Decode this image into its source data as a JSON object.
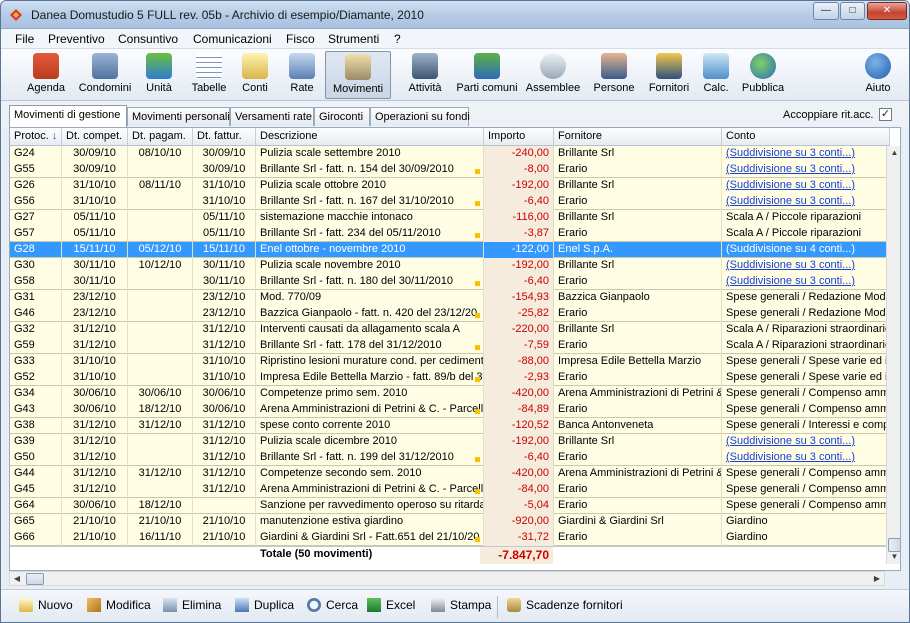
{
  "window": {
    "title": "Danea Domustudio 5 FULL rev. 05b - Archivio di esempio/Diamante, 2010"
  },
  "menu": [
    "File",
    "Preventivo",
    "Consuntivo",
    "Comunicazioni",
    "Fisco",
    "Strumenti",
    "?"
  ],
  "toolbar": [
    "Agenda",
    "Condomini",
    "Unità",
    "Tabelle",
    "Conti",
    "Rate",
    "Movimenti",
    "Attività",
    "Parti comuni",
    "Assemblee",
    "Persone",
    "Fornitori",
    "Calc.",
    "Pubblica",
    "Aiuto"
  ],
  "tabs": [
    "Movimenti di gestione",
    "Movimenti personali",
    "Versamenti rate",
    "Giroconti",
    "Operazioni su fondi"
  ],
  "accoppiare_label": "Accoppiare rit.acc.",
  "columns": [
    "Protoc.",
    "Dt. compet.",
    "Dt. pagam.",
    "Dt. fattur.",
    "Descrizione",
    "Importo",
    "Fornitore",
    "Conto"
  ],
  "rows": [
    [
      "G24",
      "30/09/10",
      "08/10/10",
      "30/09/10",
      "Pulizia scale settembre 2010",
      "-240,00",
      "Brillante Srl",
      "(Suddivisione su 3 conti...)"
    ],
    [
      "G55",
      "30/09/10",
      "",
      "30/09/10",
      "Brillante Srl - fatt. n. 154 del 30/09/2010",
      "-8,00",
      "Erario",
      "(Suddivisione su 3 conti...)"
    ],
    [
      "G26",
      "31/10/10",
      "08/11/10",
      "31/10/10",
      "Pulizia scale ottobre 2010",
      "-192,00",
      "Brillante Srl",
      "(Suddivisione su 3 conti...)"
    ],
    [
      "G56",
      "31/10/10",
      "",
      "31/10/10",
      "Brillante Srl - fatt. n. 167 del 31/10/2010",
      "-6,40",
      "Erario",
      "(Suddivisione su 3 conti...)"
    ],
    [
      "G27",
      "05/11/10",
      "",
      "05/11/10",
      "sistemazione macchie intonaco",
      "-116,00",
      "Brillante Srl",
      "Scala A / Piccole riparazioni"
    ],
    [
      "G57",
      "05/11/10",
      "",
      "05/11/10",
      "Brillante Srl - fatt. 234 del 05/11/2010",
      "-3,87",
      "Erario",
      "Scala A / Piccole riparazioni"
    ],
    [
      "G28",
      "15/11/10",
      "05/12/10",
      "15/11/10",
      "Enel ottobre - novembre 2010",
      "-122,00",
      "Enel S.p.A.",
      "(Suddivisione su 4 conti...)"
    ],
    [
      "G30",
      "30/11/10",
      "10/12/10",
      "30/11/10",
      "Pulizia scale novembre 2010",
      "-192,00",
      "Brillante Srl",
      "(Suddivisione su 3 conti...)"
    ],
    [
      "G58",
      "30/11/10",
      "",
      "30/11/10",
      "Brillante Srl - fatt. n. 180 del 30/11/2010",
      "-6,40",
      "Erario",
      "(Suddivisione su 3 conti...)"
    ],
    [
      "G31",
      "23/12/10",
      "",
      "23/12/10",
      "Mod. 770/09",
      "-154,93",
      "Bazzica Gianpaolo",
      "Spese generali / Redazione Mod."
    ],
    [
      "G46",
      "23/12/10",
      "",
      "23/12/10",
      "Bazzica Gianpaolo - fatt. n. 420 del 23/12/20",
      "-25,82",
      "Erario",
      "Spese generali / Redazione Mod."
    ],
    [
      "G32",
      "31/12/10",
      "",
      "31/12/10",
      "Interventi causati da allagamento scala A",
      "-220,00",
      "Brillante Srl",
      "Scala A / Riparazioni straordinarie"
    ],
    [
      "G59",
      "31/12/10",
      "",
      "31/12/10",
      "Brillante Srl - fatt. 178 del 31/12/2010",
      "-7,59",
      "Erario",
      "Scala A / Riparazioni straordinarie"
    ],
    [
      "G33",
      "31/10/10",
      "",
      "31/10/10",
      "Ripristino lesioni murature cond. per cedimento s",
      "-88,00",
      "Impresa Edile Bettella Marzio",
      "Spese generali / Spese varie ed im"
    ],
    [
      "G52",
      "31/10/10",
      "",
      "31/10/10",
      "Impresa Edile Bettella Marzio - fatt. 89/b del 3",
      "-2,93",
      "Erario",
      "Spese generali / Spese varie ed im"
    ],
    [
      "G34",
      "30/06/10",
      "30/06/10",
      "30/06/10",
      "Competenze primo sem. 2010",
      "-420,00",
      "Arena Amministrazioni di Petrini & C",
      "Spese generali / Compenso ammi"
    ],
    [
      "G43",
      "30/06/10",
      "18/12/10",
      "30/06/10",
      "Arena Amministrazioni di Petrini & C. - Parcella",
      "-84,89",
      "Erario",
      "Spese generali / Compenso ammi"
    ],
    [
      "G38",
      "31/12/10",
      "31/12/10",
      "31/12/10",
      "spese conto corrente 2010",
      "-120,52",
      "Banca Antonveneta",
      "Spese generali / Interessi e comp"
    ],
    [
      "G39",
      "31/12/10",
      "",
      "31/12/10",
      "Pulizia scale dicembre 2010",
      "-192,00",
      "Brillante Srl",
      "(Suddivisione su 3 conti...)"
    ],
    [
      "G50",
      "31/12/10",
      "",
      "31/12/10",
      "Brillante Srl - fatt. n. 199 del 31/12/2010",
      "-6,40",
      "Erario",
      "(Suddivisione su 3 conti...)"
    ],
    [
      "G44",
      "31/12/10",
      "31/12/10",
      "31/12/10",
      "Competenze secondo sem. 2010",
      "-420,00",
      "Arena Amministrazioni di Petrini & C",
      "Spese generali / Compenso ammi"
    ],
    [
      "G45",
      "31/12/10",
      "",
      "31/12/10",
      "Arena Amministrazioni di Petrini & C. - Parcella",
      "-84,00",
      "Erario",
      "Spese generali / Compenso ammi"
    ],
    [
      "G64",
      "30/06/10",
      "18/12/10",
      "",
      "Sanzione per ravvedimento operoso su ritardato",
      "-5,04",
      "Erario",
      "Spese generali / Compenso ammi"
    ],
    [
      "G65",
      "21/10/10",
      "21/10/10",
      "21/10/10",
      "manutenzione estiva giardino",
      "-920,00",
      "Giardini & Giardini Srl",
      "Giardino"
    ],
    [
      "G66",
      "21/10/10",
      "16/11/10",
      "21/10/10",
      "Giardini & Giardini Srl - Fatt.651 del 21/10/20",
      "-31,72",
      "Erario",
      "Giardino"
    ]
  ],
  "total": {
    "label": "Totale (50 movimenti)",
    "value": "-7.847,70"
  },
  "bottom": [
    "Nuovo",
    "Modifica",
    "Elimina",
    "Duplica",
    "Cerca",
    "Excel",
    "Stampa",
    "Scadenze fornitori"
  ]
}
